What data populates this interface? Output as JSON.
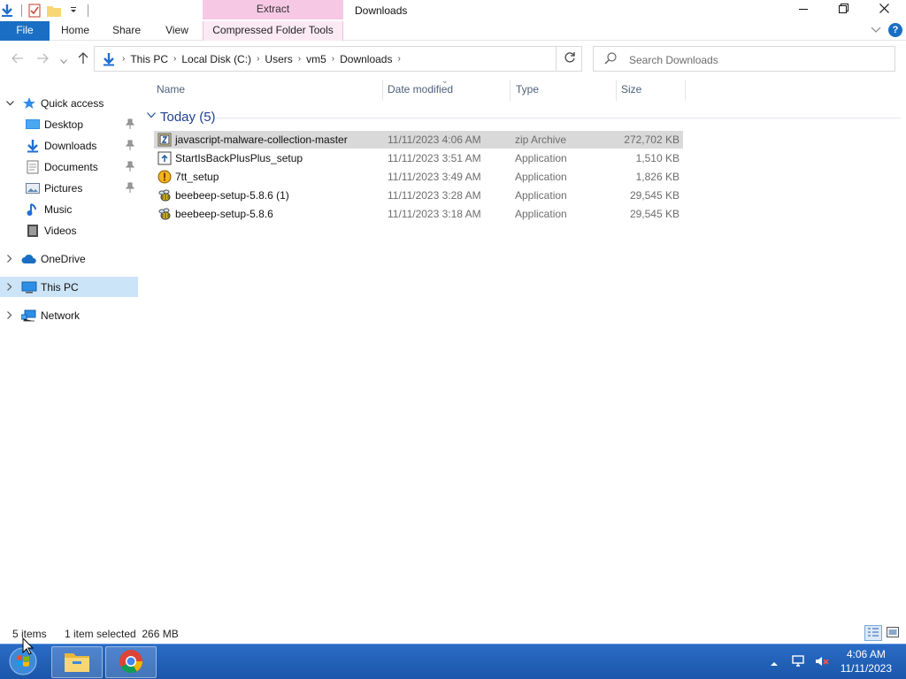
{
  "window": {
    "title": "Downloads",
    "context_tab_header": "Extract"
  },
  "ribbon": {
    "tabs": [
      "File",
      "Home",
      "Share",
      "View",
      "Compressed Folder Tools"
    ]
  },
  "address": {
    "crumbs": [
      "This PC",
      "Local Disk (C:)",
      "Users",
      "vm5",
      "Downloads"
    ]
  },
  "search": {
    "placeholder": "Search Downloads"
  },
  "nav": {
    "quick_access": "Quick access",
    "items": [
      {
        "label": "Desktop",
        "icon": "desktop-icon",
        "pinned": true
      },
      {
        "label": "Downloads",
        "icon": "downloads-icon",
        "pinned": true
      },
      {
        "label": "Documents",
        "icon": "documents-icon",
        "pinned": true
      },
      {
        "label": "Pictures",
        "icon": "pictures-icon",
        "pinned": true
      },
      {
        "label": "Music",
        "icon": "music-icon",
        "pinned": false
      },
      {
        "label": "Videos",
        "icon": "videos-icon",
        "pinned": false
      }
    ],
    "onedrive": "OneDrive",
    "this_pc": "This PC",
    "network": "Network"
  },
  "columns": {
    "name": "Name",
    "date": "Date modified",
    "type": "Type",
    "size": "Size"
  },
  "group": {
    "title": "Today (5)"
  },
  "files": [
    {
      "name": "javascript-malware-collection-master",
      "date": "11/11/2023 4:06 AM",
      "type": "zip Archive",
      "size": "272,702 KB",
      "icon": "zip-archive-icon",
      "selected": true
    },
    {
      "name": "StartIsBackPlusPlus_setup",
      "date": "11/11/2023 3:51 AM",
      "type": "Application",
      "size": "1,510 KB",
      "icon": "installer-icon",
      "selected": false
    },
    {
      "name": "7tt_setup",
      "date": "11/11/2023 3:49 AM",
      "type": "Application",
      "size": "1,826 KB",
      "icon": "7tt-app-icon",
      "selected": false
    },
    {
      "name": "beebeep-setup-5.8.6 (1)",
      "date": "11/11/2023 3:28 AM",
      "type": "Application",
      "size": "29,545 KB",
      "icon": "beebeep-app-icon",
      "selected": false
    },
    {
      "name": "beebeep-setup-5.8.6",
      "date": "11/11/2023 3:18 AM",
      "type": "Application",
      "size": "29,545 KB",
      "icon": "beebeep-app-icon",
      "selected": false
    }
  ],
  "status": {
    "count": "5 items",
    "selection": "1 item selected  266 MB"
  },
  "taskbar": {
    "time": "4:06 AM",
    "date": "11/11/2023"
  },
  "colors": {
    "accent": "#1a6fc4",
    "selection": "#cce4f7",
    "context_tab": "#f7c8e4",
    "taskbar": "#2a6cc6"
  }
}
